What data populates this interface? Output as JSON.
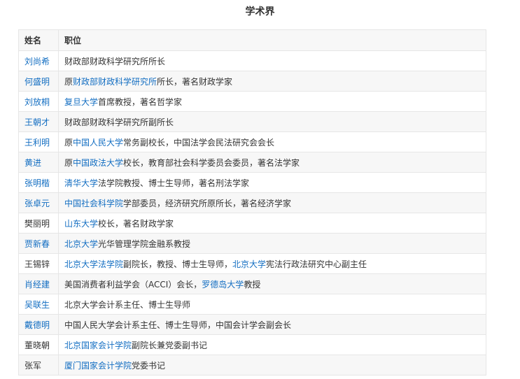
{
  "caption": "学术界",
  "headers": {
    "name": "姓名",
    "position": "职位"
  },
  "colors": {
    "link": "#136ec2",
    "text": "#333333",
    "border": "#e6e6e6",
    "header_bg": "#f7f7f7"
  },
  "rows": [
    {
      "name": "刘尚希",
      "name_link": true,
      "parts": [
        {
          "t": "财政部财政科学研究所所长",
          "link": false
        }
      ]
    },
    {
      "name": "何盛明",
      "name_link": true,
      "parts": [
        {
          "t": "原",
          "link": false
        },
        {
          "t": "财政部财政科学研究所",
          "link": true
        },
        {
          "t": "所长，著名财政学家",
          "link": false
        }
      ]
    },
    {
      "name": "刘放桐",
      "name_link": true,
      "parts": [
        {
          "t": "复旦大学",
          "link": true
        },
        {
          "t": "首席教授，著名哲学家",
          "link": false
        }
      ]
    },
    {
      "name": "王朝才",
      "name_link": true,
      "parts": [
        {
          "t": "财政部财政科学研究所副所长",
          "link": false
        }
      ]
    },
    {
      "name": "王利明",
      "name_link": true,
      "parts": [
        {
          "t": "原",
          "link": false
        },
        {
          "t": "中国人民大学",
          "link": true
        },
        {
          "t": "常务副校长，中国法学会民法研究会会长",
          "link": false
        }
      ]
    },
    {
      "name": "黄进",
      "name_link": true,
      "parts": [
        {
          "t": "原",
          "link": false
        },
        {
          "t": "中国政法大学",
          "link": true
        },
        {
          "t": "校长，教育部社会科学委员会委员，著名法学家",
          "link": false
        }
      ]
    },
    {
      "name": "张明楷",
      "name_link": true,
      "parts": [
        {
          "t": "清华大学",
          "link": true
        },
        {
          "t": "法学院教授、博士生导师，著名刑法学家",
          "link": false
        }
      ]
    },
    {
      "name": "张卓元",
      "name_link": true,
      "parts": [
        {
          "t": "中国社会科学院",
          "link": true
        },
        {
          "t": "学部委员，经济研究所原所长，著名经济学家",
          "link": false
        }
      ]
    },
    {
      "name": "樊丽明",
      "name_link": false,
      "parts": [
        {
          "t": "山东大学",
          "link": true
        },
        {
          "t": "校长，著名财政学家",
          "link": false
        }
      ]
    },
    {
      "name": "贾新春",
      "name_link": true,
      "parts": [
        {
          "t": "北京大学",
          "link": true
        },
        {
          "t": "光华管理学院金融系教授",
          "link": false
        }
      ]
    },
    {
      "name": "王锡锌",
      "name_link": false,
      "parts": [
        {
          "t": "北京大学法学院",
          "link": true
        },
        {
          "t": "副院长，教授、博士生导师，",
          "link": false
        },
        {
          "t": "北京大学",
          "link": true
        },
        {
          "t": "宪法行政法研究中心副主任",
          "link": false
        }
      ]
    },
    {
      "name": "肖经建",
      "name_link": true,
      "parts": [
        {
          "t": "美国消费者利益学会（ACCI）会长，",
          "link": false
        },
        {
          "t": "罗德岛大学",
          "link": true
        },
        {
          "t": "教授",
          "link": false
        }
      ]
    },
    {
      "name": "吴联生",
      "name_link": true,
      "parts": [
        {
          "t": "北京大学会计系主任、博士生导师",
          "link": false
        }
      ]
    },
    {
      "name": "戴德明",
      "name_link": true,
      "parts": [
        {
          "t": "中国人民大学会计系主任、博士生导师，中国会计学会副会长",
          "link": false
        }
      ]
    },
    {
      "name": "董晓朝",
      "name_link": false,
      "parts": [
        {
          "t": "北京国家会计学院",
          "link": true
        },
        {
          "t": "副院长兼党委副书记",
          "link": false
        }
      ]
    },
    {
      "name": "张军",
      "name_link": false,
      "parts": [
        {
          "t": "厦门国家会计学院",
          "link": true
        },
        {
          "t": "党委书记",
          "link": false
        }
      ]
    }
  ]
}
